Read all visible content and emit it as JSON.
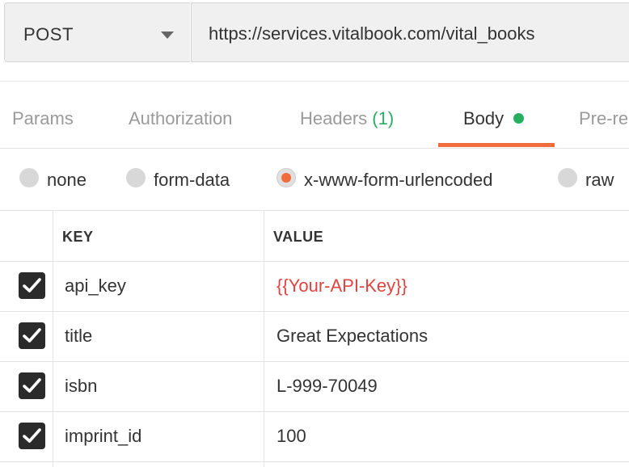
{
  "request": {
    "method": "POST",
    "url": "https://services.vitalbook.com/vital_books"
  },
  "tabs": [
    {
      "label": "Params"
    },
    {
      "label": "Authorization"
    },
    {
      "label": "Headers",
      "count": "(1)"
    },
    {
      "label": "Body",
      "active": true,
      "status_dot_color": "#27ae60"
    },
    {
      "label": "Pre-re"
    }
  ],
  "body_types": [
    {
      "label": "none",
      "selected": false
    },
    {
      "label": "form-data",
      "selected": false
    },
    {
      "label": "x-www-form-urlencoded",
      "selected": true
    },
    {
      "label": "raw",
      "selected": false
    }
  ],
  "table": {
    "headers": {
      "key": "KEY",
      "value": "VALUE"
    },
    "rows": [
      {
        "checked": true,
        "key": "api_key",
        "value": "{{Your-API-Key}}",
        "is_variable": true
      },
      {
        "checked": true,
        "key": "title",
        "value": "Great Expectations"
      },
      {
        "checked": true,
        "key": "isbn",
        "value": "L-999-70049"
      },
      {
        "checked": true,
        "key": "imprint_id",
        "value": "100"
      }
    ]
  },
  "colors": {
    "accent": "#f26b3a",
    "success": "#27ae60",
    "variable": "#e0443f"
  }
}
